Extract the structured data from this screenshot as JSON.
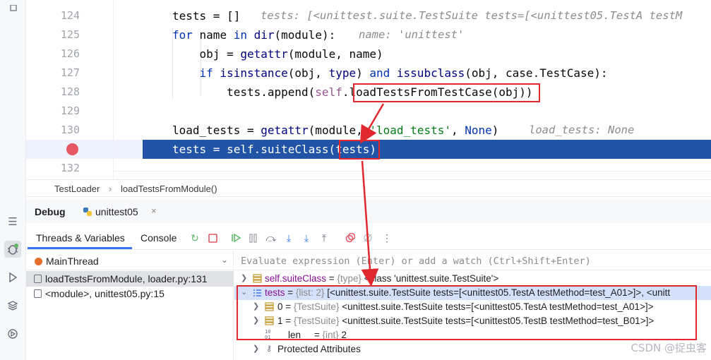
{
  "editor": {
    "lines": [
      {
        "num": "124",
        "tokens": [
          [
            "",
            "tests = []"
          ]
        ],
        "hint": "tests: [<unittest.suite.TestSuite tests=[<unittest05.TestA testM"
      },
      {
        "num": "125",
        "tokens": [
          [
            "kw",
            "for"
          ],
          [
            "",
            " name "
          ],
          [
            "kw",
            "in"
          ],
          [
            "",
            " "
          ],
          [
            "bi",
            "dir"
          ],
          [
            "",
            "(module):"
          ]
        ],
        "hint": "name: 'unittest'"
      },
      {
        "num": "126",
        "tokens": [
          [
            "",
            "    obj = "
          ],
          [
            "bi",
            "getattr"
          ],
          [
            "",
            "(module, name)"
          ]
        ],
        "hint": ""
      },
      {
        "num": "127",
        "tokens": [
          [
            "",
            "    "
          ],
          [
            "kw",
            "if"
          ],
          [
            "",
            " "
          ],
          [
            "bi",
            "isinstance"
          ],
          [
            "",
            "(obj, "
          ],
          [
            "bi",
            "type"
          ],
          [
            "",
            ") "
          ],
          [
            "kw",
            "and"
          ],
          [
            "",
            " "
          ],
          [
            "bi",
            "issubclass"
          ],
          [
            "",
            "(obj, case.TestCase):"
          ]
        ],
        "hint": ""
      },
      {
        "num": "128",
        "tokens": [
          [
            "",
            "        tests.append("
          ],
          [
            "self",
            "self"
          ],
          [
            "",
            ".loadTestsFromTestCase(obj))"
          ]
        ],
        "hint": ""
      },
      {
        "num": "129",
        "tokens": [],
        "hint": ""
      },
      {
        "num": "130",
        "tokens": [
          [
            "",
            "load_tests = "
          ],
          [
            "bi",
            "getattr"
          ],
          [
            "",
            "(module, "
          ],
          [
            "str",
            "'load_tests'"
          ],
          [
            "",
            ", "
          ],
          [
            "kw",
            "None"
          ],
          [
            "",
            ")"
          ]
        ],
        "hint": "load_tests: None"
      },
      {
        "num": "",
        "tokens": [
          [
            "",
            "tests = self.suiteClass(tests)"
          ]
        ],
        "hint": ""
      },
      {
        "num": "132",
        "tokens": [],
        "hint": ""
      }
    ],
    "current_line_code": "tests = self.suiteClass(tests)"
  },
  "breadcrumb": {
    "class_name": "TestLoader",
    "method_name": "loadTestsFromModule()"
  },
  "debug": {
    "title": "Debug",
    "session": "unittest05",
    "session_close": "×",
    "tabs": {
      "threads_variables": "Threads & Variables",
      "console": "Console"
    }
  },
  "threads": {
    "selected_thread": "MainThread",
    "frames": [
      "loadTestsFromModule, loader.py:131",
      "<module>, unittest05.py:15"
    ]
  },
  "variables": {
    "eval_placeholder": "Evaluate expression (Enter) or add a watch (Ctrl+Shift+Enter)",
    "rows": [
      {
        "name": "self.suiteClass",
        "eq": " = ",
        "type": "{type}",
        "value": " <class 'unittest.suite.TestSuite'>"
      },
      {
        "name": "tests",
        "eq": " = ",
        "type": "{list: 2}",
        "value": " [<unittest.suite.TestSuite tests=[<unittest05.TestA testMethod=test_A01>]>, <unitt"
      },
      {
        "name": "0",
        "eq": " = ",
        "type": "{TestSuite}",
        "value": " <unittest.suite.TestSuite tests=[<unittest05.TestA testMethod=test_A01>]>"
      },
      {
        "name": "1",
        "eq": " = ",
        "type": "{TestSuite}",
        "value": " <unittest.suite.TestSuite tests=[<unittest05.TestB testMethod=test_B01>]>"
      },
      {
        "name": "__len__",
        "eq": " = ",
        "type": "{int}",
        "value": " 2"
      },
      {
        "name": "Protected Attributes",
        "eq": "",
        "type": "",
        "value": ""
      }
    ],
    "len_icon_text": "10\n01"
  },
  "watermark": "CSDN @捉虫客",
  "colors": {
    "exec_line": "#2154a6",
    "highlight_box": "#e0292f",
    "breakpoint": "#e55765",
    "selection": "#dfe1e5"
  }
}
